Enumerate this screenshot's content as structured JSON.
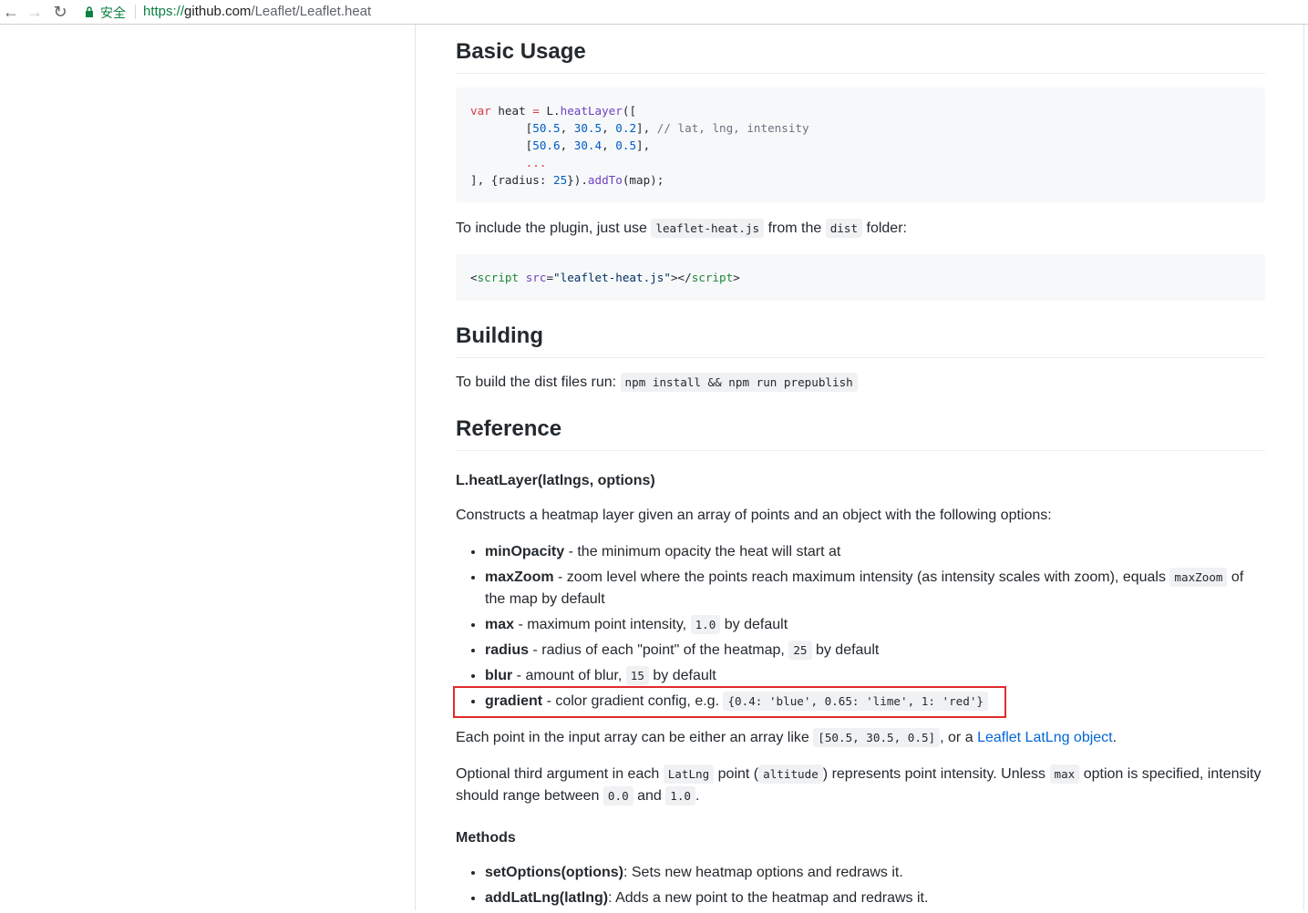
{
  "browser": {
    "secure_label": "安全",
    "url_proto": "https://",
    "url_host": "github.com",
    "url_path": "/Leaflet/Leaflet.heat"
  },
  "basic_usage": {
    "heading": "Basic Usage",
    "code_lines": [
      [
        [
          "kw",
          "var"
        ],
        [
          "pl",
          " heat "
        ],
        [
          "kw",
          "="
        ],
        [
          "pl",
          " "
        ],
        [
          "pl",
          "L."
        ],
        [
          "fn",
          "heatLayer"
        ],
        [
          "pl",
          "(["
        ]
      ],
      [
        [
          "pl",
          "        ["
        ],
        [
          "num",
          "50.5"
        ],
        [
          "pl",
          ", "
        ],
        [
          "num",
          "30.5"
        ],
        [
          "pl",
          ", "
        ],
        [
          "num",
          "0.2"
        ],
        [
          "pl",
          "], "
        ],
        [
          "com",
          "// lat, lng, intensity"
        ]
      ],
      [
        [
          "pl",
          "        ["
        ],
        [
          "num",
          "50.6"
        ],
        [
          "pl",
          ", "
        ],
        [
          "num",
          "30.4"
        ],
        [
          "pl",
          ", "
        ],
        [
          "num",
          "0.5"
        ],
        [
          "pl",
          "],"
        ]
      ],
      [
        [
          "pl",
          "        "
        ],
        [
          "kw",
          "..."
        ]
      ],
      [
        [
          "pl",
          "], {radius: "
        ],
        [
          "num",
          "25"
        ],
        [
          "pl",
          "})."
        ],
        [
          "fn",
          "addTo"
        ],
        [
          "pl",
          "(map);"
        ]
      ]
    ],
    "include_text_1": "To include the plugin, just use",
    "include_code_1": "leaflet-heat.js",
    "include_text_2": "from the",
    "include_code_2": "dist",
    "include_text_3": "folder:",
    "script_line": [
      [
        "pl",
        "<"
      ],
      [
        "tag",
        "script"
      ],
      [
        "pl",
        " "
      ],
      [
        "attr",
        "src"
      ],
      [
        "pl",
        "="
      ],
      [
        "str",
        "\"leaflet-heat.js\""
      ],
      [
        "pl",
        "></"
      ],
      [
        "tag",
        "script"
      ],
      [
        "pl",
        ">"
      ]
    ]
  },
  "building": {
    "heading": "Building",
    "text": "To build the dist files run:",
    "code": "npm install && npm run prepublish"
  },
  "reference": {
    "heading": "Reference",
    "signature": "L.heatLayer(latlngs, options)",
    "intro": "Constructs a heatmap layer given an array of points and an object with the following options:",
    "options": [
      {
        "name": "minOpacity",
        "parts": [
          [
            "t",
            " - the minimum opacity the heat will start at"
          ]
        ]
      },
      {
        "name": "maxZoom",
        "parts": [
          [
            "t",
            " - zoom level where the points reach maximum intensity (as intensity scales with zoom), equals "
          ],
          [
            "c",
            "maxZoom"
          ],
          [
            "t",
            " of the map by default"
          ]
        ]
      },
      {
        "name": "max",
        "parts": [
          [
            "t",
            " - maximum point intensity, "
          ],
          [
            "c",
            "1.0"
          ],
          [
            "t",
            " by default"
          ]
        ]
      },
      {
        "name": "radius",
        "parts": [
          [
            "t",
            " - radius of each \"point\" of the heatmap, "
          ],
          [
            "c",
            "25"
          ],
          [
            "t",
            " by default"
          ]
        ]
      },
      {
        "name": "blur",
        "parts": [
          [
            "t",
            " - amount of blur, "
          ],
          [
            "c",
            "15"
          ],
          [
            "t",
            " by default"
          ]
        ]
      },
      {
        "name": "gradient",
        "parts": [
          [
            "t",
            " - color gradient config, e.g. "
          ],
          [
            "c",
            "{0.4: 'blue', 0.65: 'lime', 1: 'red'}"
          ]
        ]
      }
    ],
    "each_point_1": "Each point in the input array can be either an array like",
    "each_point_code": "[50.5, 30.5, 0.5]",
    "each_point_2": ", or a",
    "each_point_link": "Leaflet LatLng object",
    "each_point_3": ".",
    "optional_1": "Optional third argument in each",
    "optional_code_1": "LatLng",
    "optional_2": "point (",
    "optional_code_2": "altitude",
    "optional_3": ") represents point intensity. Unless",
    "optional_code_3": "max",
    "optional_4": "option is specified, intensity should range between",
    "optional_code_4": "0.0",
    "optional_5": "and",
    "optional_code_5": "1.0",
    "optional_6": ".",
    "methods_heading": "Methods",
    "methods": [
      {
        "name": "setOptions(options)",
        "desc": ": Sets new heatmap options and redraws it."
      },
      {
        "name": "addLatLng(latlng)",
        "desc": ": Adds a new point to the heatmap and redraws it."
      }
    ]
  }
}
